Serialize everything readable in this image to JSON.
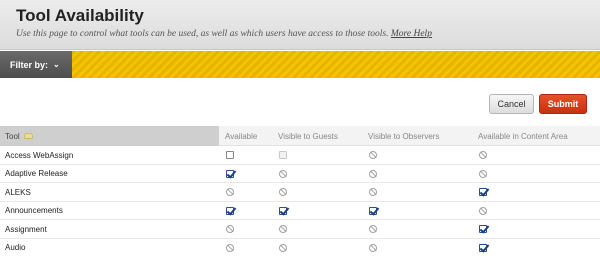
{
  "header": {
    "title": "Tool Availability",
    "description": "Use this page to control what tools can be used, as well as which users have access to those tools.",
    "more_help": "More Help"
  },
  "filter": {
    "label": "Filter by:"
  },
  "actions": {
    "cancel": "Cancel",
    "submit": "Submit"
  },
  "table": {
    "headers": [
      "Tool",
      "Available",
      "Visible to Guests",
      "Visible to Observers",
      "Available in Content Area"
    ],
    "rows": [
      {
        "tool": "Access WebAssign",
        "cells": [
          "unchecked",
          "disabled",
          "na",
          "na"
        ]
      },
      {
        "tool": "Adaptive Release",
        "cells": [
          "checked",
          "na",
          "na",
          "na"
        ]
      },
      {
        "tool": "ALEKS",
        "cells": [
          "na",
          "na",
          "na",
          "checked"
        ]
      },
      {
        "tool": "Announcements",
        "cells": [
          "checked",
          "checked",
          "checked",
          "na"
        ]
      },
      {
        "tool": "Assignment",
        "cells": [
          "na",
          "na",
          "na",
          "checked"
        ]
      },
      {
        "tool": "Audio",
        "cells": [
          "na",
          "na",
          "na",
          "checked"
        ]
      }
    ]
  }
}
